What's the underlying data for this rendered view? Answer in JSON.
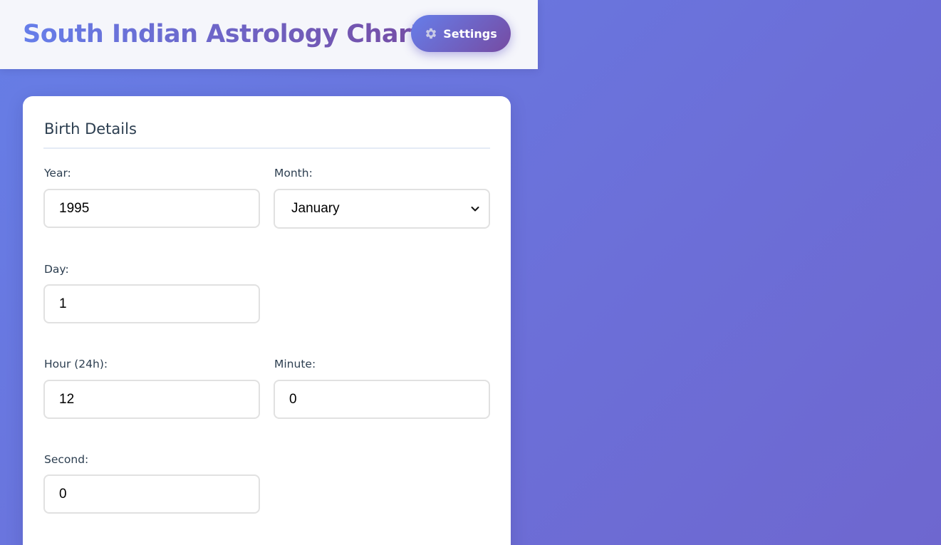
{
  "header": {
    "title": "South Indian Astrology Charts",
    "settings_label": "Settings",
    "settings_icon": "gear-icon"
  },
  "form": {
    "section_title": "Birth Details",
    "year": {
      "label": "Year:",
      "value": "1995"
    },
    "month": {
      "label": "Month:",
      "value": "January"
    },
    "day": {
      "label": "Day:",
      "value": "1"
    },
    "hour": {
      "label": "Hour (24h):",
      "value": "12"
    },
    "minute": {
      "label": "Minute:",
      "value": "0"
    },
    "second": {
      "label": "Second:",
      "value": "0"
    }
  },
  "colors": {
    "accent_start": "#667eea",
    "accent_end": "#764ba2",
    "text": "#2c3e50"
  }
}
